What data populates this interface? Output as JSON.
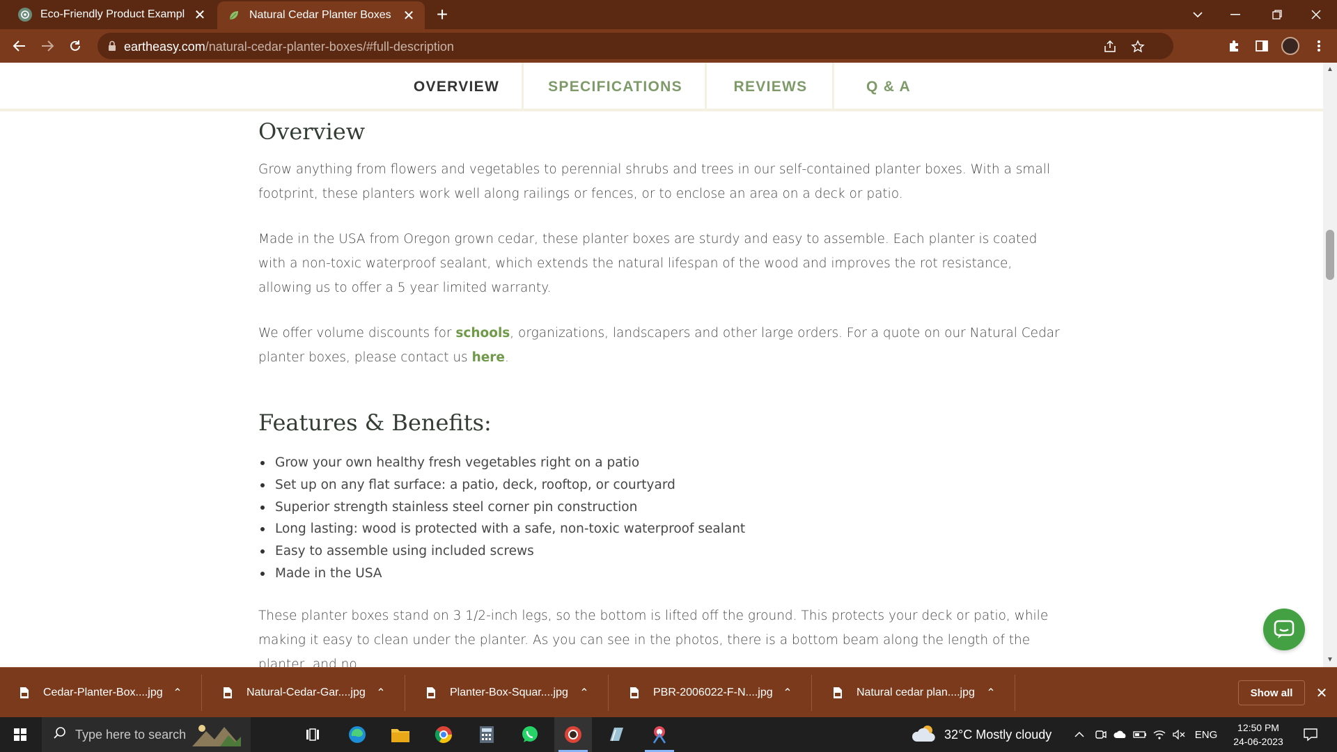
{
  "browser": {
    "tabs": [
      {
        "title": "Eco-Friendly Product Examples",
        "active": false,
        "favicon": "openai-icon"
      },
      {
        "title": "Natural Cedar Planter Boxes | Ear",
        "active": true,
        "favicon": "leaf-icon"
      }
    ],
    "url_domain": "eartheasy.com",
    "url_path": "/natural-cedar-planter-boxes/#full-description"
  },
  "page": {
    "tabs": [
      {
        "label": "OVERVIEW",
        "active": true
      },
      {
        "label": "SPECIFICATIONS",
        "active": false
      },
      {
        "label": "REVIEWS",
        "active": false
      },
      {
        "label": "Q & A",
        "active": false
      }
    ],
    "overview_heading": "Overview",
    "p1": "Grow anything from flowers and vegetables to perennial shrubs and trees in our self-contained planter boxes. With a small footprint, these planters work well along railings or fences, or to enclose an area on a deck or patio.",
    "p2": "Made in the USA from Oregon grown cedar, these planter boxes are sturdy and easy to assemble. Each planter is coated with a non-toxic waterproof sealant, which extends the natural lifespan of the wood and improves the rot resistance, allowing us to offer a 5 year limited warranty.",
    "p3_a": "We offer volume discounts for ",
    "p3_link1": "schools",
    "p3_b": ", organizations, landscapers and other large orders. For a quote on our Natural Cedar planter boxes, please contact us ",
    "p3_link2": "here",
    "p3_c": ".",
    "features_heading": "Features & Benefits:",
    "features": [
      "Grow your own healthy fresh vegetables right on a patio",
      "Set up on any flat surface: a patio, deck, rooftop, or courtyard",
      "Superior strength stainless steel corner pin construction",
      "Long lasting: wood is protected with a safe, non-toxic waterproof sealant",
      "Easy to assemble using included screws",
      "Made in the USA"
    ],
    "p4": "These planter boxes stand on 3 1/2-inch legs, so the bottom is lifted off the ground. This protects your deck or patio, while making it easy to clean under the planter. As you can see in the photos, there is a bottom beam along the length of the planter, and no"
  },
  "downloads": {
    "items": [
      "Cedar-Planter-Box....jpg",
      "Natural-Cedar-Gar....jpg",
      "Planter-Box-Squar....jpg",
      "PBR-2006022-F-N....jpg",
      "Natural cedar plan....jpg"
    ],
    "show_all": "Show all"
  },
  "taskbar": {
    "search_placeholder": "Type here to search",
    "weather": "32°C  Mostly cloudy",
    "lang": "ENG",
    "time": "12:50 PM",
    "date": "24-06-2023"
  },
  "colors": {
    "chrome_frame": "#5b2812",
    "chrome_toolbar": "#7a3a1b",
    "link_green": "#6f9a4a",
    "tab_green": "#7d9a68",
    "chat_green": "#43a043"
  }
}
